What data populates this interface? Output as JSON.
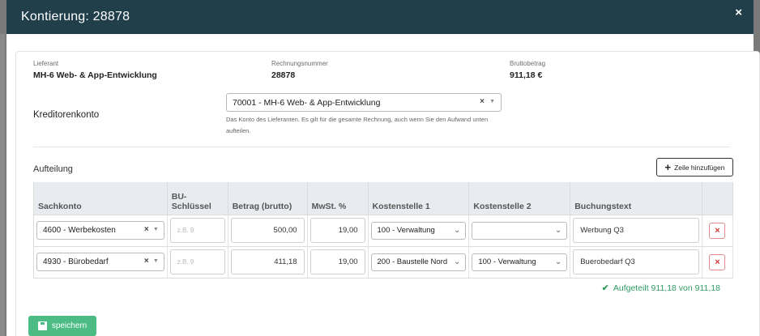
{
  "modal": {
    "title": "Kontierung: 28878",
    "close": "×"
  },
  "invoice": {
    "lieferant_label": "Lieferant",
    "lieferant_value": "MH-6 Web- & App-Entwicklung",
    "rechnungsnummer_label": "Rechnungsnummer",
    "rechnungsnummer_value": "28878",
    "brutto_label": "Bruttobetrag",
    "brutto_value": "911,18 €"
  },
  "kreditor": {
    "label": "Kreditorenkonto",
    "selected": "70001 - MH-6 Web- & App-Entwicklung",
    "help": "Das Konto des Lieferanten. Es gilt für die gesamte Rechnung, auch wenn Sie den Aufwand unten aufteilen."
  },
  "aufteilung": {
    "label": "Aufteilung",
    "add_button": "Zeile hinzufügen"
  },
  "table": {
    "headers": {
      "sachkonto": "Sachkonto",
      "bu": "BU-\nSchlüssel",
      "betrag": "Betrag (brutto)",
      "mwst": "MwSt. %",
      "ks1": "Kostenstelle 1",
      "ks2": "Kostenstelle 2",
      "text": "Buchungstext"
    },
    "rows": [
      {
        "sachkonto": "4600 - Werbekosten",
        "bu_placeholder": "z.B. 9",
        "betrag": "500,00",
        "mwst": "19,00",
        "ks1": "100 - Verwaltung",
        "ks2": "",
        "text": "Werbung Q3"
      },
      {
        "sachkonto": "4930 - Bürobedarf",
        "bu_placeholder": "z.B. 9",
        "betrag": "411,18",
        "mwst": "19,00",
        "ks1": "200 - Baustelle Nord",
        "ks2": "100 - Verwaltung",
        "text": "Buerobedarf Q3"
      }
    ]
  },
  "status": {
    "text": "Aufgeteilt 911,18 von 911,18",
    "color": "#2e9c61"
  },
  "save": {
    "label": "speichern",
    "color": "#4cbc84"
  },
  "colors": {
    "header": "#213f4a",
    "danger": "#d23c3c"
  }
}
